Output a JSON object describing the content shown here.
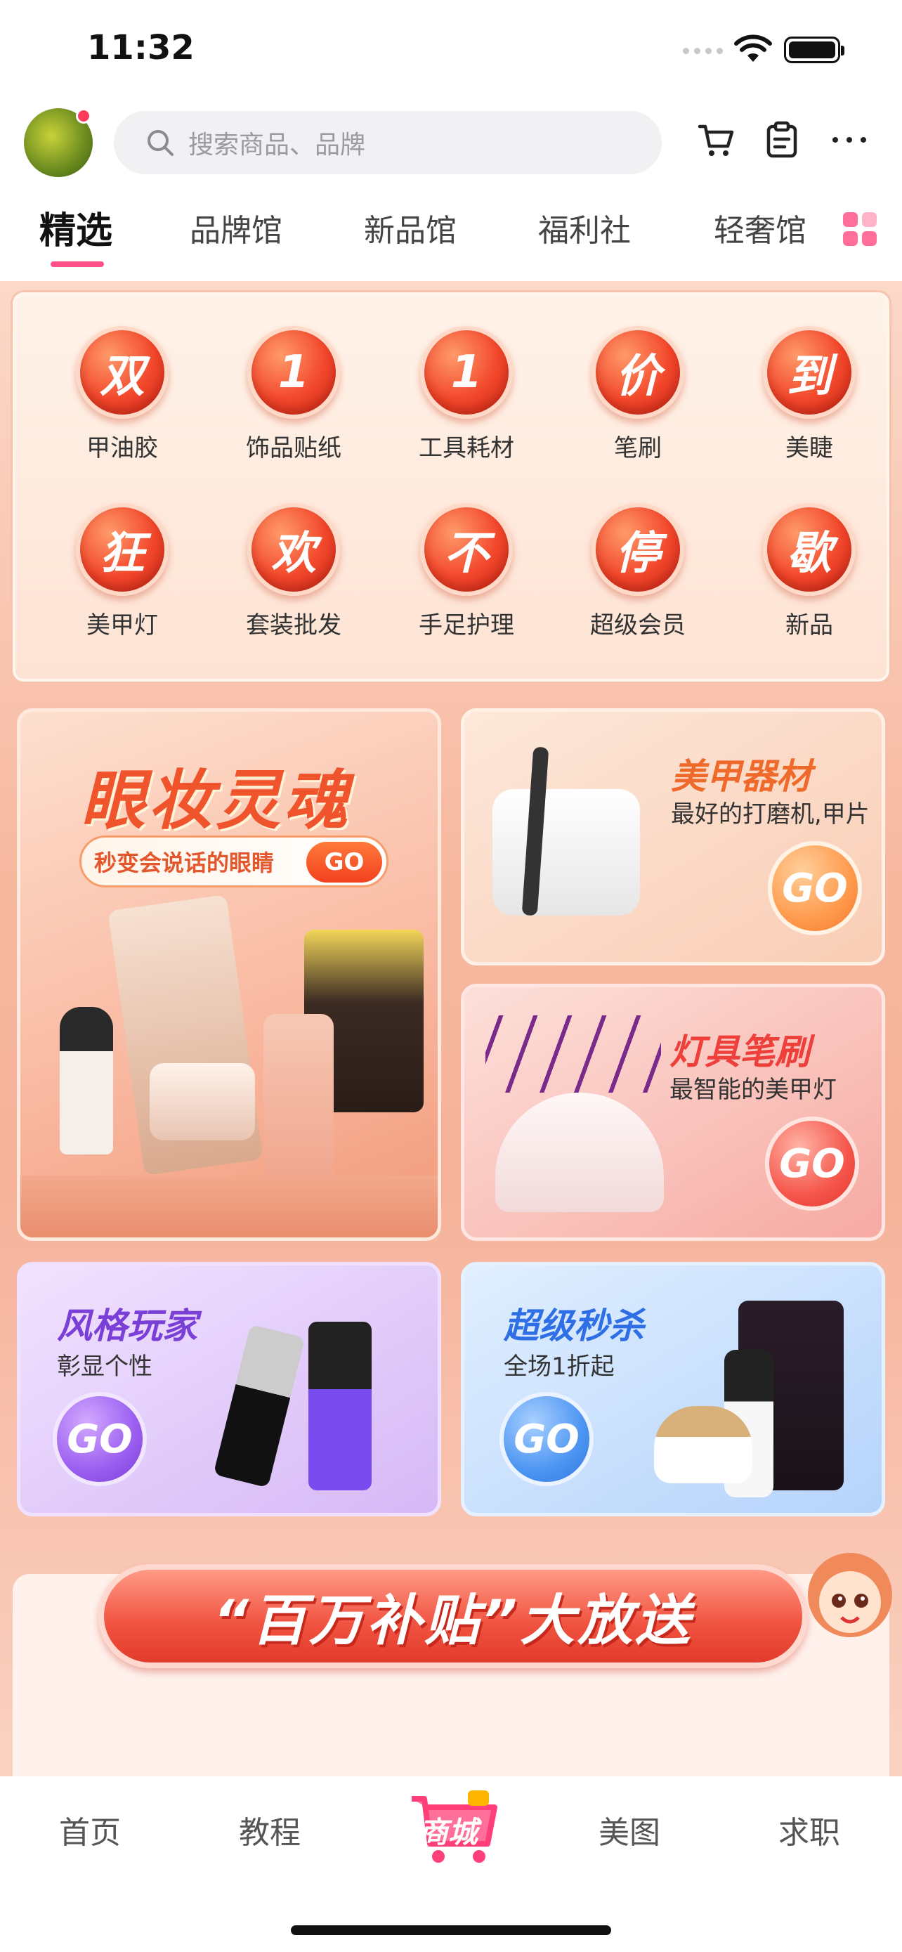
{
  "status_bar": {
    "time": "11:32"
  },
  "search": {
    "placeholder": "搜索商品、品牌"
  },
  "tabs": [
    {
      "label": "精选"
    },
    {
      "label": "品牌馆"
    },
    {
      "label": "新品馆"
    },
    {
      "label": "福利社"
    },
    {
      "label": "轻奢馆"
    }
  ],
  "categories": [
    {
      "char": "双",
      "label": "甲油胶"
    },
    {
      "char": "1",
      "label": "饰品贴纸"
    },
    {
      "char": "1",
      "label": "工具耗材"
    },
    {
      "char": "价",
      "label": "笔刷"
    },
    {
      "char": "到",
      "label": "美睫"
    },
    {
      "char": "狂",
      "label": "美甲灯"
    },
    {
      "char": "欢",
      "label": "套装批发"
    },
    {
      "char": "不",
      "label": "手足护理"
    },
    {
      "char": "停",
      "label": "超级会员"
    },
    {
      "char": "歇",
      "label": "新品"
    }
  ],
  "promos": {
    "eye": {
      "title": "眼妆灵魂",
      "pill": "秒变会说话的眼睛",
      "go": "GO"
    },
    "tools": {
      "title": "美甲器材",
      "subtitle": "最好的打磨机,甲片",
      "go": "GO"
    },
    "lamps": {
      "title": "灯具笔刷",
      "subtitle": "最智能的美甲灯",
      "go": "GO"
    },
    "style": {
      "title": "风格玩家",
      "subtitle": "彰显个性",
      "go": "GO"
    },
    "flash": {
      "title": "超级秒杀",
      "subtitle": "全场1折起",
      "go": "GO"
    }
  },
  "subsidy_banner": {
    "text": "“百万补贴”大放送"
  },
  "bottom_nav": {
    "home": "首页",
    "tutorial": "教程",
    "shop": "商城",
    "gallery": "美图",
    "jobs": "求职"
  },
  "colors": {
    "accent": "#ff4f86",
    "promo_red": "#f2472b"
  }
}
